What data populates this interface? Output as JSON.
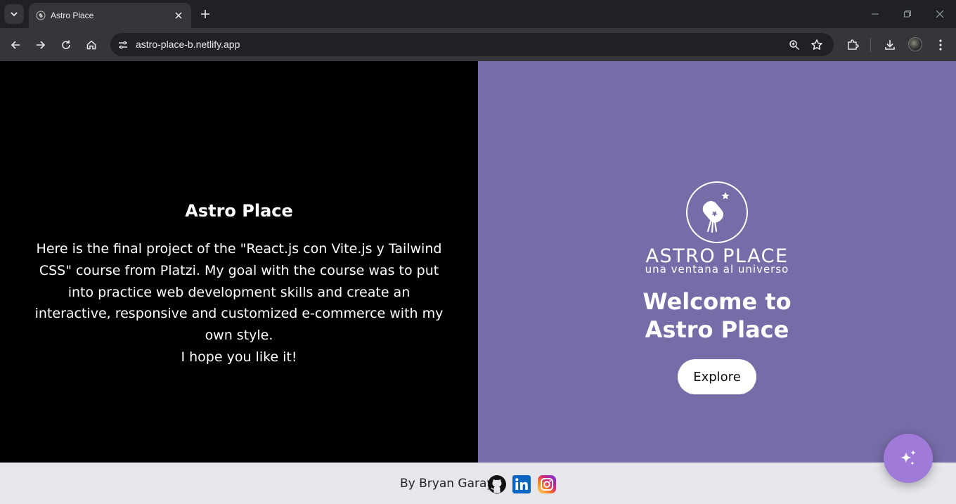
{
  "browser": {
    "tab_title": "Astro Place",
    "url": "astro-place-b.netlify.app"
  },
  "about": {
    "title": "Astro Place",
    "body": "Here is the final project of the \"React.js con Vite.js y Tailwind CSS\" course from Platzi. My goal with the course was to put into practice web development skills and create an interactive, responsive and customized e-commerce with my own style.",
    "closing": "I hope you like it!"
  },
  "hero": {
    "logo_name": "ASTRO PLACE",
    "logo_tagline": "una ventana al universo",
    "welcome": "Welcome to Astro Place",
    "explore_label": "Explore"
  },
  "footer": {
    "credit": "By Bryan Garay",
    "socials": [
      "github-icon",
      "linkedin-icon",
      "instagram-icon"
    ]
  },
  "colors": {
    "hero_bg": "#776ca8",
    "about_bg": "#000000",
    "footer_bg": "#e5e7eb",
    "fab_bg": "#a07ad9"
  }
}
